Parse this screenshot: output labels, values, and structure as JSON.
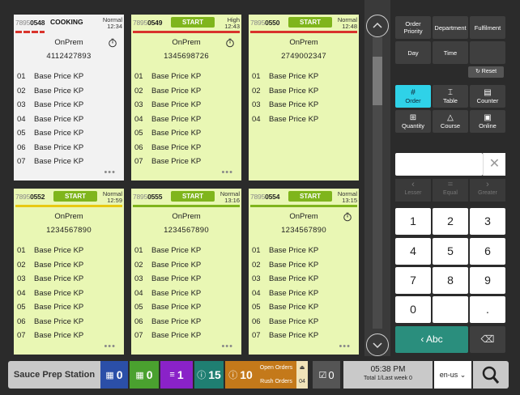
{
  "tickets": [
    {
      "id_prefix": "7895",
      "id_suffix": "0548",
      "status": "COOKING",
      "priority": "Normal",
      "time": "12:34",
      "bar": "dashed",
      "timer": true,
      "type": "OnPrem",
      "phone": "4112427893",
      "lines": [
        {
          "n": "01",
          "d": "Base Price KP"
        },
        {
          "n": "02",
          "d": "Base Price KP"
        },
        {
          "n": "03",
          "d": "Base Price KP"
        },
        {
          "n": "04",
          "d": "Base Price KP"
        },
        {
          "n": "05",
          "d": "Base Price KP"
        },
        {
          "n": "06",
          "d": "Base Price KP"
        },
        {
          "n": "07",
          "d": "Base Price KP"
        }
      ],
      "more": "•••"
    },
    {
      "id_prefix": "7895",
      "id_suffix": "0549",
      "status": "START",
      "priority": "High",
      "time": "12:43",
      "bar": "red",
      "timer": true,
      "type": "OnPrem",
      "phone": "1345698726",
      "lines": [
        {
          "n": "01",
          "d": "Base Price KP"
        },
        {
          "n": "02",
          "d": "Base Price KP"
        },
        {
          "n": "03",
          "d": "Base Price KP"
        },
        {
          "n": "04",
          "d": "Base Price KP"
        },
        {
          "n": "05",
          "d": "Base Price KP"
        },
        {
          "n": "06",
          "d": "Base Price KP"
        },
        {
          "n": "07",
          "d": "Base Price KP"
        }
      ],
      "more": "•••"
    },
    {
      "id_prefix": "7895",
      "id_suffix": "0550",
      "status": "START",
      "priority": "Normal",
      "time": "12:48",
      "bar": "red",
      "timer": false,
      "type": "OnPrem",
      "phone": "2749002347",
      "lines": [
        {
          "n": "01",
          "d": "Base Price KP"
        },
        {
          "n": "02",
          "d": "Base Price KP"
        },
        {
          "n": "03",
          "d": "Base Price KP"
        },
        {
          "n": "04",
          "d": "Base Price KP"
        }
      ],
      "more": ""
    },
    {
      "id_prefix": "7895",
      "id_suffix": "0552",
      "status": "START",
      "priority": "Normal",
      "time": "12:59",
      "bar": "yellow",
      "timer": false,
      "type": "OnPrem",
      "phone": "1234567890",
      "lines": [
        {
          "n": "01",
          "d": "Base Price KP"
        },
        {
          "n": "02",
          "d": "Base Price KP"
        },
        {
          "n": "03",
          "d": "Base Price KP"
        },
        {
          "n": "04",
          "d": "Base Price KP"
        },
        {
          "n": "05",
          "d": "Base Price KP"
        },
        {
          "n": "06",
          "d": "Base Price KP"
        },
        {
          "n": "07",
          "d": "Base Price KP"
        }
      ],
      "more": "•••"
    },
    {
      "id_prefix": "7895",
      "id_suffix": "0555",
      "status": "START",
      "priority": "Normal",
      "time": "13:16",
      "bar": "green",
      "timer": false,
      "type": "OnPrem",
      "phone": "1234567890",
      "lines": [
        {
          "n": "01",
          "d": "Base Price KP"
        },
        {
          "n": "02",
          "d": "Base Price KP"
        },
        {
          "n": "03",
          "d": "Base Price KP"
        },
        {
          "n": "04",
          "d": "Base Price KP"
        },
        {
          "n": "05",
          "d": "Base Price KP"
        },
        {
          "n": "06",
          "d": "Base Price KP"
        },
        {
          "n": "07",
          "d": "Base Price KP"
        }
      ],
      "more": "•••"
    },
    {
      "id_prefix": "7895",
      "id_suffix": "0554",
      "status": "START",
      "priority": "Normal",
      "time": "13:15",
      "bar": "green",
      "timer": true,
      "type": "OnPrem",
      "phone": "1234567890",
      "lines": [
        {
          "n": "01",
          "d": "Base Price KP"
        },
        {
          "n": "02",
          "d": "Base Price KP"
        },
        {
          "n": "03",
          "d": "Base Price KP"
        },
        {
          "n": "04",
          "d": "Base Price KP"
        },
        {
          "n": "05",
          "d": "Base Price KP"
        },
        {
          "n": "06",
          "d": "Base Price KP"
        },
        {
          "n": "07",
          "d": "Base Price KP"
        }
      ],
      "more": "•••"
    }
  ],
  "sort": {
    "order_priority": "Order Priority",
    "department": "Department",
    "fulfilment": "Fulfilment",
    "day": "Day",
    "time": "Time",
    "reset": "Reset"
  },
  "view": {
    "order": "Order",
    "table": "Table",
    "counter": "Counter",
    "quantity": "Quantity",
    "course": "Course",
    "online": "Online"
  },
  "compare": {
    "lesser": "Lesser",
    "equal": "Equal",
    "greater": "Greater"
  },
  "keypad": {
    "k1": "1",
    "k2": "2",
    "k3": "3",
    "k4": "4",
    "k5": "5",
    "k6": "6",
    "k7": "7",
    "k8": "8",
    "k9": "9",
    "k0": "0",
    "dot": ".",
    "abc": "Abc"
  },
  "bottom": {
    "station": "Sauce Prep Station",
    "count_blue": "0",
    "count_green": "0",
    "count_purple": "1",
    "count_teal": "15",
    "count_orange": "10",
    "open_orders": "Open Orders",
    "rush_orders": "Rush Orders",
    "rush_count": "04",
    "done_count": "0",
    "time": "05:38 PM",
    "total": "Total 1/Last week 0",
    "lang": "en-us"
  },
  "colors": {
    "ticket_bg": "#e9f7b4",
    "status_green": "#7fb51c",
    "active_cyan": "#2fd2e8",
    "abc_teal": "#2a8e7d"
  }
}
